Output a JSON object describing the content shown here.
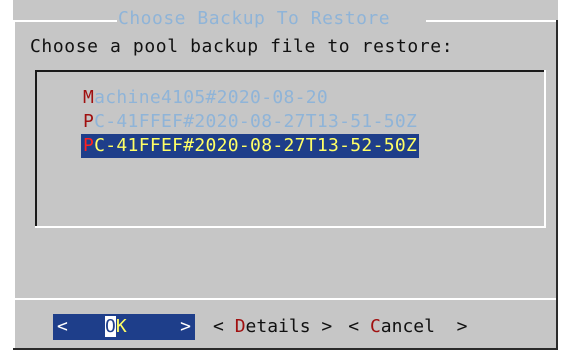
{
  "dialog": {
    "title": "Choose Backup To Restore",
    "prompt": "Choose a pool backup file to restore:"
  },
  "list": {
    "items": [
      {
        "hotkey": "M",
        "rest": "achine4105#2020-08-20",
        "selected": false
      },
      {
        "hotkey": "P",
        "rest": "C-41FFEF#2020-08-27T13-51-50Z",
        "selected": false
      },
      {
        "hotkey": "P",
        "rest": "C-41FFEF#2020-08-27T13-52-50Z",
        "selected": true
      }
    ]
  },
  "buttons": {
    "ok": {
      "left": "<",
      "hotkey": "O",
      "rest": "K",
      "right": ">"
    },
    "details": {
      "left": "< ",
      "hotkey": "D",
      "rest": "etails",
      "right": " >"
    },
    "cancel": {
      "left": "< ",
      "hotkey": "C",
      "rest": "ancel",
      "right": "  >"
    }
  },
  "colors": {
    "dialog_bg": "#c6c6c6",
    "title": "#8fb4d8",
    "selection_bg": "#1e3e8a",
    "selection_fg": "#ffff66",
    "hotkey": "#a01010"
  }
}
